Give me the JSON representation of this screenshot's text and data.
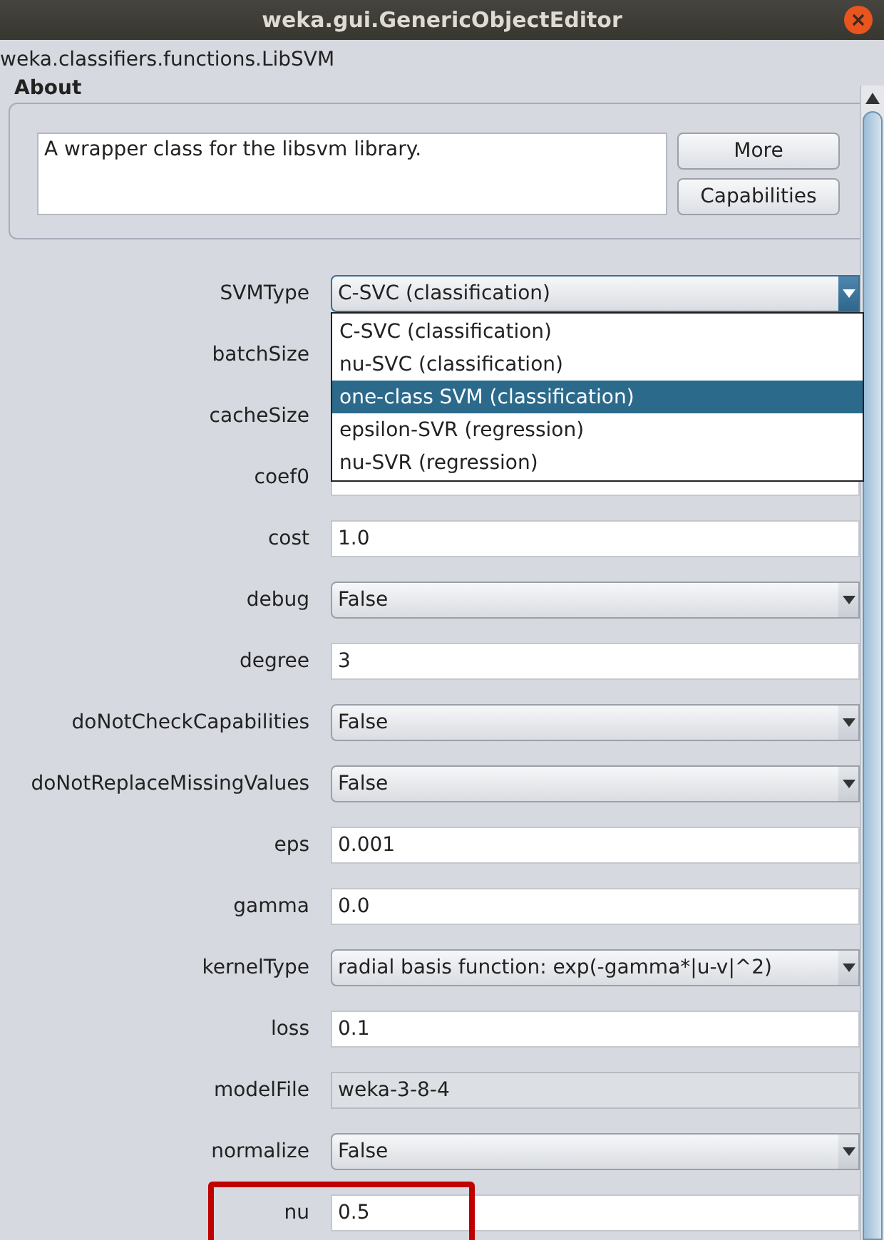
{
  "window": {
    "title": "weka.gui.GenericObjectEditor"
  },
  "class_name": "weka.classifiers.functions.LibSVM",
  "about": {
    "heading": "About",
    "text": "A wrapper class for the libsvm library.",
    "buttons": [
      "More",
      "Capabilities"
    ]
  },
  "properties": [
    {
      "label": "SVMType",
      "kind": "combo",
      "value": "C-SVC (classification)",
      "expanded": true,
      "highlighted": false
    },
    {
      "label": "batchSize",
      "kind": "text",
      "highlighted": false
    },
    {
      "label": "cacheSize",
      "kind": "text",
      "highlighted": false
    },
    {
      "label": "coef0",
      "kind": "text",
      "highlighted": false
    },
    {
      "label": "cost",
      "kind": "text",
      "value": "1.0",
      "highlighted": false
    },
    {
      "label": "debug",
      "kind": "combo",
      "value": "False",
      "expanded": false,
      "highlighted": false
    },
    {
      "label": "degree",
      "kind": "text",
      "value": "3",
      "highlighted": false
    },
    {
      "label": "doNotCheckCapabilities",
      "kind": "combo",
      "value": "False",
      "expanded": false,
      "highlighted": false
    },
    {
      "label": "doNotReplaceMissingValues",
      "kind": "combo",
      "value": "False",
      "expanded": false,
      "highlighted": false
    },
    {
      "label": "eps",
      "kind": "text",
      "value": "0.001",
      "highlighted": false
    },
    {
      "label": "gamma",
      "kind": "text",
      "value": "0.0",
      "highlighted": false
    },
    {
      "label": "kernelType",
      "kind": "combo",
      "value": "radial basis function: exp(-gamma*|u-v|^2)",
      "expanded": false,
      "highlighted": false
    },
    {
      "label": "loss",
      "kind": "text",
      "value": "0.1",
      "highlighted": false
    },
    {
      "label": "modelFile",
      "kind": "readonly",
      "value": "weka-3-8-4",
      "highlighted": false
    },
    {
      "label": "normalize",
      "kind": "combo",
      "value": "False",
      "expanded": false,
      "highlighted": false
    },
    {
      "label": "nu",
      "kind": "text",
      "value": "0.5",
      "highlighted": true
    }
  ],
  "svm_type_options": [
    {
      "label": "C-SVC (classification)",
      "selected": false
    },
    {
      "label": "nu-SVC (classification)",
      "selected": false
    },
    {
      "label": "one-class SVM (classification)",
      "selected": true
    },
    {
      "label": "epsilon-SVR (regression)",
      "selected": false
    },
    {
      "label": "nu-SVR (regression)",
      "selected": false
    }
  ]
}
